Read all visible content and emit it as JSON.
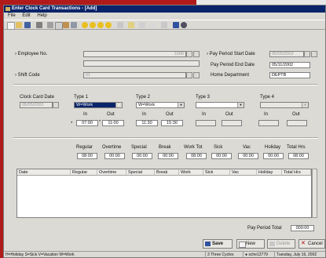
{
  "window": {
    "title": "Enter Clock Card Transactions - [Add]"
  },
  "menu": [
    "File",
    "Edit",
    "Help"
  ],
  "toolbar_icons": [
    "new-icon",
    "open-icon",
    "save-icon",
    "undo-icon",
    "cut-icon",
    "copy-icon",
    "paste-icon",
    "find-icon",
    "first-icon",
    "prev-icon",
    "next-icon",
    "last-icon",
    "print-icon",
    "preview-icon",
    "notes-icon",
    "help-icon",
    "calendar-icon",
    "attach-icon"
  ],
  "header": {
    "employee_no_label": "Employee No.",
    "employee_no_value": "1000",
    "shift_code_label": "Shift Code",
    "shift_code_value": "01",
    "pay_period_start_label": "Pay Period Start Date",
    "pay_period_start_value": "05/05/2002",
    "pay_period_end_label": "Pay Period End Date",
    "pay_period_end_value": "05/11/2002",
    "home_department_label": "Home Department",
    "home_department_value": "DEPTB"
  },
  "clock": {
    "clock_card_date_label": "Clock Card Date",
    "clock_card_date_value": "05/05/2002",
    "types": [
      {
        "label": "Type 1",
        "value": "W=Work",
        "in_label": "In",
        "out_label": "Out",
        "in_value": "07:00",
        "out_value": "11:00"
      },
      {
        "label": "Type 2",
        "value": "W=Work",
        "in_label": "In",
        "out_label": "Out",
        "in_value": "11:30",
        "out_value": "15:30"
      },
      {
        "label": "Type 3",
        "value": "",
        "in_label": "In",
        "out_label": "Out",
        "in_value": "",
        "out_value": ""
      },
      {
        "label": "Type 4",
        "value": "",
        "in_label": "In",
        "out_label": "Out",
        "in_value": "",
        "out_value": ""
      }
    ]
  },
  "totals": {
    "labels": [
      "Regular",
      "Overtime",
      "Special",
      "Break",
      "Work Tot",
      "Sick",
      "Vac",
      "Holiday",
      "Total Hrs"
    ],
    "values": [
      "08:00",
      "00:00",
      "00:00",
      "00:00",
      "08:00",
      "00:00",
      "00:00",
      "00:00",
      "08:00"
    ]
  },
  "grid": {
    "columns": [
      "Date",
      "Regular",
      "Overtime",
      "Special",
      "Break",
      "Work",
      "Sick",
      "Vac",
      "Holiday",
      "Total Hrs"
    ]
  },
  "pay_period_total_label": "Pay Period Total",
  "pay_period_total_value": "000:00",
  "buttons": {
    "save": "Save",
    "new": "New",
    "delete": "Delete",
    "cancel": "Cancel"
  },
  "status": {
    "legend": "H=Holiday  S=Sick  V=Vacation  W=Work",
    "cycles": "3 Three Cycles",
    "user": "sche12779",
    "date": "Tuesday, July 16, 2002"
  },
  "colors": {
    "title_bar": "#0a246a",
    "background": "#b01a1a",
    "window": "#dcdad5"
  }
}
